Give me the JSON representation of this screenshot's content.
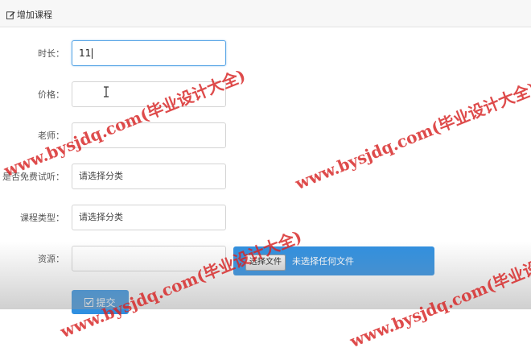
{
  "panel": {
    "title": "增加课程",
    "icon": "edit-icon"
  },
  "form": {
    "duration": {
      "label": "时长：",
      "value": "11"
    },
    "price": {
      "label": "价格：",
      "value": ""
    },
    "teacher": {
      "label": "老师：",
      "value": ""
    },
    "free_trial": {
      "label": "是否免费试听：",
      "value": "请选择分类"
    },
    "course_type": {
      "label": "课程类型：",
      "value": "请选择分类"
    },
    "resource": {
      "label": "资源：",
      "value": "",
      "file_button": "选择文件",
      "file_status": "未选择任何文件"
    },
    "submit": {
      "label": "提交",
      "icon": "check-icon"
    }
  },
  "watermark": {
    "text": "www.bysjdq.com(毕业设计大全)"
  },
  "colors": {
    "primary": "#2f8fe0",
    "watermark": "#d72323",
    "focus_border": "#5aa6e6"
  }
}
